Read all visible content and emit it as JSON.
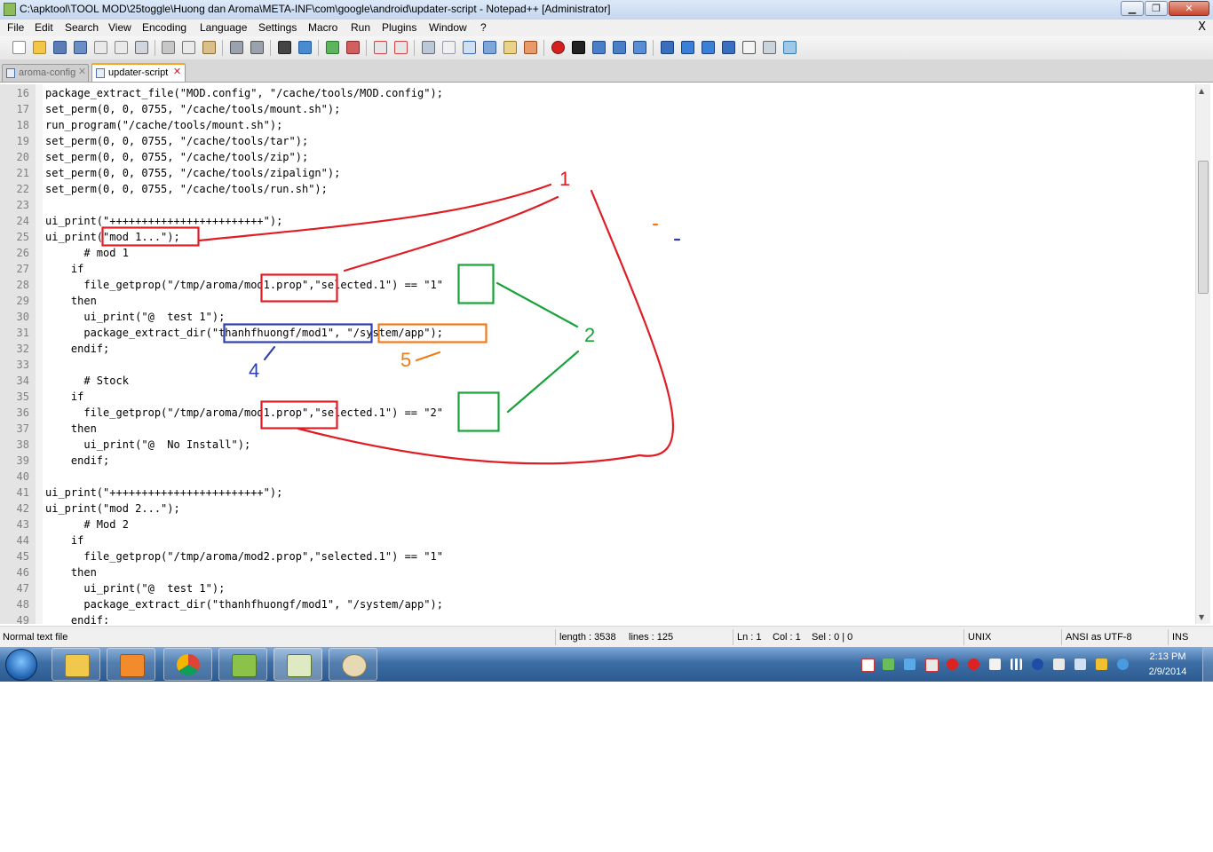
{
  "window": {
    "title": "C:\\apktool\\TOOL MOD\\25toggle\\Huong dan Aroma\\META-INF\\com\\google\\android\\updater-script - Notepad++ [Administrator]",
    "minimize": "▁",
    "maximize": "❐",
    "close": "✕"
  },
  "menu": [
    "File",
    "Edit",
    "Search",
    "View",
    "Encoding",
    "Language",
    "Settings",
    "Macro",
    "Run",
    "Plugins",
    "Window",
    "?"
  ],
  "menu_close": "X",
  "toolbar_icons": [
    "new-file-icon",
    "open-file-icon",
    "save-icon",
    "save-all-icon",
    "close-icon",
    "close-all-icon",
    "print-icon",
    "cut-icon",
    "copy-icon",
    "paste-icon",
    "undo-icon",
    "redo-icon",
    "find-icon",
    "replace-icon",
    "zoom-in-icon",
    "zoom-out-icon",
    "sync-vertical-icon",
    "sync-horizontal-icon",
    "word-wrap-icon",
    "show-all-chars-icon",
    "indent-guide-icon",
    "user-language-icon",
    "doc-map-icon",
    "function-list-icon",
    "record-macro-icon",
    "stop-record-icon",
    "play-macro-icon",
    "run-macro-multiple-icon",
    "save-macro-icon",
    "collapse-icon",
    "move-up-icon",
    "move-down-icon",
    "expand-icon",
    "spellcheck-icon",
    "spellcheck-settings-icon",
    "spellcheck-options-icon"
  ],
  "tabs": [
    {
      "label": "aroma-config",
      "active": false
    },
    {
      "label": "updater-script",
      "active": true
    }
  ],
  "editor": {
    "lines": [
      {
        "n": "16",
        "text": "package_extract_file(\"MOD.config\", \"/cache/tools/MOD.config\");"
      },
      {
        "n": "17",
        "text": "set_perm(0, 0, 0755, \"/cache/tools/mount.sh\");"
      },
      {
        "n": "18",
        "text": "run_program(\"/cache/tools/mount.sh\");"
      },
      {
        "n": "19",
        "text": "set_perm(0, 0, 0755, \"/cache/tools/tar\");"
      },
      {
        "n": "20",
        "text": "set_perm(0, 0, 0755, \"/cache/tools/zip\");"
      },
      {
        "n": "21",
        "text": "set_perm(0, 0, 0755, \"/cache/tools/zipalign\");"
      },
      {
        "n": "22",
        "text": "set_perm(0, 0, 0755, \"/cache/tools/run.sh\");"
      },
      {
        "n": "23",
        "text": ""
      },
      {
        "n": "24",
        "text": "ui_print(\"++++++++++++++++++++++++\");"
      },
      {
        "n": "25",
        "text": "ui_print(\"mod 1...\");"
      },
      {
        "n": "26",
        "text": "      # mod 1"
      },
      {
        "n": "27",
        "text": "    if"
      },
      {
        "n": "28",
        "text": "      file_getprop(\"/tmp/aroma/mod1.prop\",\"selected.1\") == \"1\""
      },
      {
        "n": "29",
        "text": "    then"
      },
      {
        "n": "30",
        "text": "      ui_print(\"@  test 1\");"
      },
      {
        "n": "31",
        "text": "      package_extract_dir(\"thanhfhuongf/mod1\", \"/system/app\");"
      },
      {
        "n": "32",
        "text": "    endif;"
      },
      {
        "n": "33",
        "text": ""
      },
      {
        "n": "34",
        "text": "      # Stock"
      },
      {
        "n": "35",
        "text": "    if"
      },
      {
        "n": "36",
        "text": "      file_getprop(\"/tmp/aroma/mod1.prop\",\"selected.1\") == \"2\""
      },
      {
        "n": "37",
        "text": "    then"
      },
      {
        "n": "38",
        "text": "      ui_print(\"@  No Install\");"
      },
      {
        "n": "39",
        "text": "    endif;"
      },
      {
        "n": "40",
        "text": ""
      },
      {
        "n": "41",
        "text": "ui_print(\"++++++++++++++++++++++++\");"
      },
      {
        "n": "42",
        "text": "ui_print(\"mod 2...\");"
      },
      {
        "n": "43",
        "text": "      # Mod 2"
      },
      {
        "n": "44",
        "text": "    if"
      },
      {
        "n": "45",
        "text": "      file_getprop(\"/tmp/aroma/mod2.prop\",\"selected.1\") == \"1\""
      },
      {
        "n": "46",
        "text": "    then"
      },
      {
        "n": "47",
        "text": "      ui_print(\"@  test 1\");"
      },
      {
        "n": "48",
        "text": "      package_extract_dir(\"thanhfhuongf/mod1\", \"/system/app\");"
      },
      {
        "n": "49",
        "text": "    endif;"
      }
    ]
  },
  "annotations": {
    "label_1": "1",
    "label_2": "2",
    "label_4": "4",
    "label_5": "5",
    "colors": {
      "red": "#e01d25",
      "green": "#17a33a",
      "blue": "#2e3fb0",
      "orange": "#f07a1a"
    }
  },
  "statusbar": {
    "type": "Normal text file",
    "length": "length : 3538",
    "lines": "lines : 125",
    "ln": "Ln : 1",
    "col": "Col : 1",
    "sel": "Sel : 0 | 0",
    "eol": "UNIX",
    "encoding": "ANSI as UTF-8",
    "mode": "INS"
  },
  "taskbar": {
    "apps": [
      "explorer-icon",
      "media-player-icon",
      "chrome-icon",
      "android-tool-icon",
      "notepadpp-icon",
      "paint-icon"
    ],
    "tray_icons": [
      "vivaldi-tray-icon",
      "network-tray-icon",
      "sync-tray-icon",
      "flag-tray-icon",
      "bug-tray-icon",
      "bug2-tray-icon",
      "usb-tray-icon",
      "signal-tray-icon",
      "bluetooth-tray-icon",
      "volume-tray-icon",
      "monitor-tray-icon",
      "wand-tray-icon",
      "update-tray-icon"
    ],
    "time": "2:13 PM",
    "date": "2/9/2014"
  }
}
